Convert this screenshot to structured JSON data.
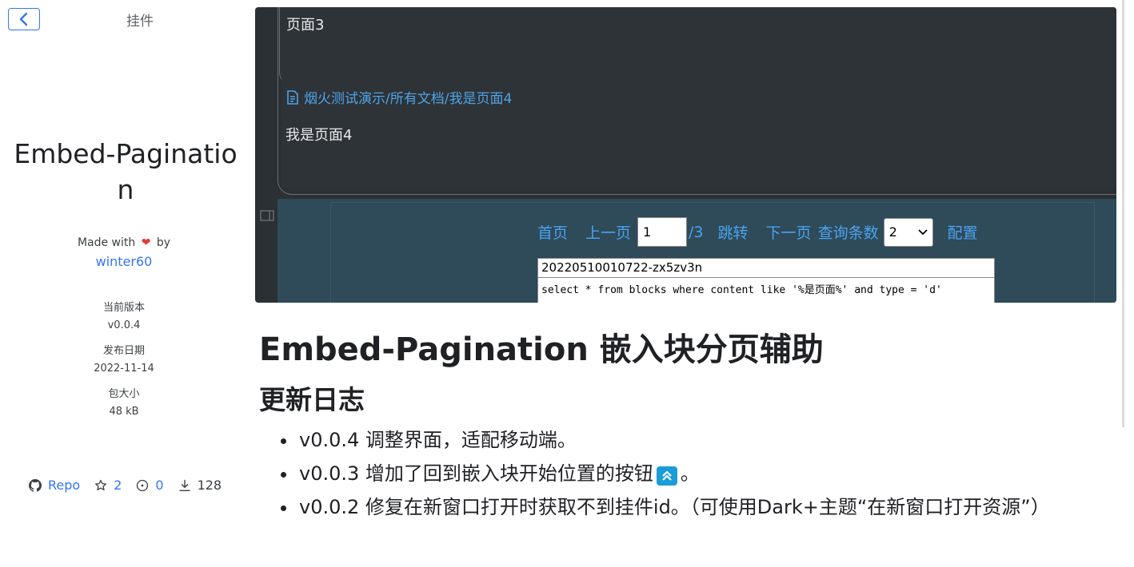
{
  "sidebar": {
    "title": "挂件",
    "package_name": "Embed-Pagination",
    "made_with_prefix": "Made with",
    "made_with_suffix": "by",
    "author": "winter60",
    "version_label": "当前版本",
    "version_value": "v0.0.4",
    "date_label": "发布日期",
    "date_value": "2022-11-14",
    "size_label": "包大小",
    "size_value": "48 kB",
    "stats": {
      "repo_label": "Repo",
      "stars": "2",
      "issues": "0",
      "downloads": "128"
    }
  },
  "preview": {
    "card1_text": "页面3",
    "card2_path": "烟火测试演示/所有文档/我是页面4",
    "card2_text": "我是页面4",
    "pager": {
      "first": "首页",
      "prev": "上一页",
      "page_value": "1",
      "total": "/3",
      "jump": "跳转",
      "next": "下一页",
      "count_label": "查询条数",
      "count_value": "2",
      "config": "配置"
    },
    "sql_id": "20220510010722-zx5zv3n",
    "sql_query": "select * from blocks where content like '%是页面%' and type = 'd'"
  },
  "readme": {
    "title": "Embed-Pagination 嵌入块分页辅助",
    "changelog_heading": "更新日志",
    "items": [
      "v0.0.4 调整界面，适配移动端。",
      "v0.0.3 增加了回到嵌入块开始位置的按钮",
      "。",
      "v0.0.2 修复在新窗口打开时获取不到挂件id。（可使用Dark+主题“在新窗口打开资源”）"
    ]
  },
  "colors": {
    "accent": "#3575f0",
    "heart": "#e53935",
    "preview_bg": "#2b3034",
    "pager_bg": "#2f4a59",
    "pager_link": "#4aa3ef",
    "inline_icon": "#1a9cd8"
  },
  "icons": [
    "chevron-left-icon",
    "heart-icon",
    "github-icon",
    "star-icon",
    "issue-icon",
    "download-icon",
    "document-icon",
    "sidebar-toggle-icon",
    "scroll-to-top-icon"
  ]
}
